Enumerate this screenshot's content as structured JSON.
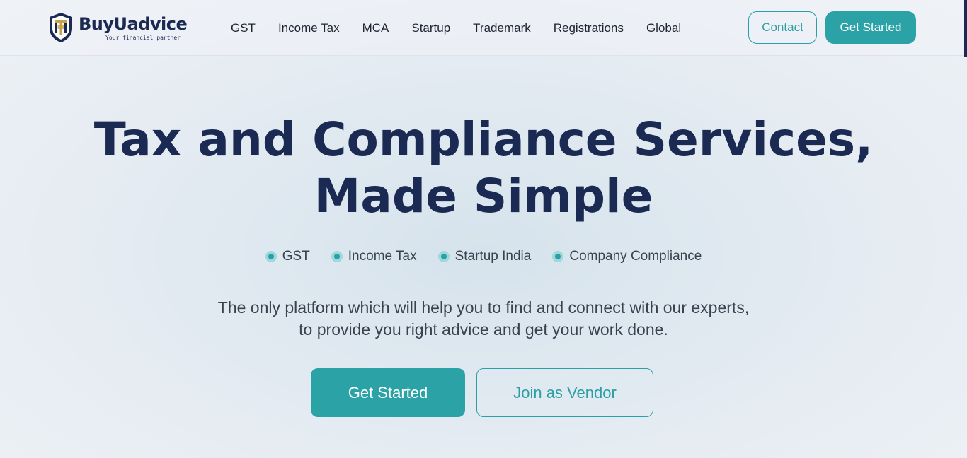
{
  "brand": {
    "name": "BuyUadvice",
    "tagline": "Your financial partner",
    "logo_icon": "shield-crest-icon"
  },
  "nav": {
    "items": [
      {
        "label": "GST"
      },
      {
        "label": "Income Tax"
      },
      {
        "label": "MCA"
      },
      {
        "label": "Startup"
      },
      {
        "label": "Trademark"
      },
      {
        "label": "Registrations"
      },
      {
        "label": "Global"
      }
    ],
    "contact_label": "Contact",
    "get_started_label": "Get Started"
  },
  "hero": {
    "title_line1": "Tax and Compliance Services,",
    "title_line2": "Made Simple",
    "tags": [
      {
        "label": "GST"
      },
      {
        "label": "Income Tax"
      },
      {
        "label": "Startup India"
      },
      {
        "label": "Company Compliance"
      }
    ],
    "subtext_line1": "The only platform which will help you to find and connect with our experts,",
    "subtext_line2": "to provide you right advice and get your work done.",
    "primary_cta": "Get Started",
    "secondary_cta": "Join as Vendor"
  },
  "colors": {
    "brand_navy": "#1b2a52",
    "accent_teal": "#2aa2a6",
    "logo_gold": "#c9a24a"
  }
}
